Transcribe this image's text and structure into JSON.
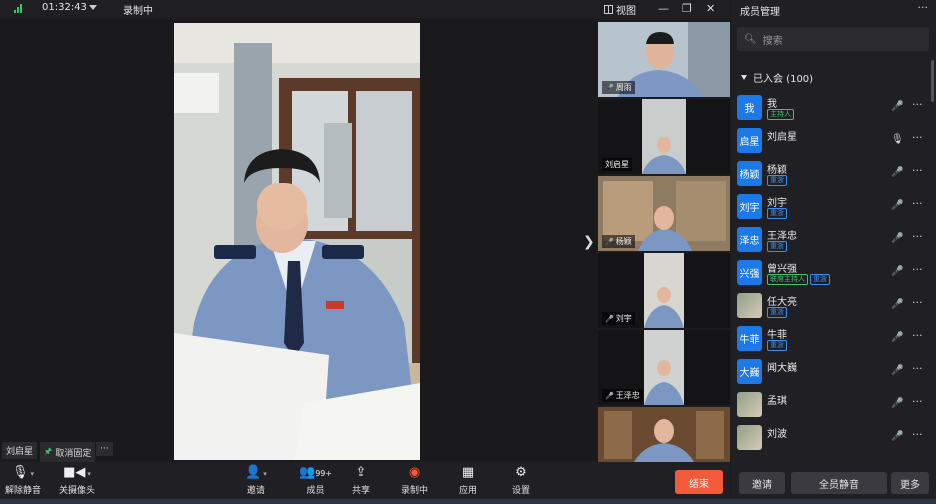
{
  "topbar": {
    "timer": "01:32:43",
    "recording_status": "录制中",
    "view_label": "视图",
    "colors": {
      "signal": "#3cc26a"
    }
  },
  "stage": {
    "pinned_name": "刘启星",
    "unpin_label": "取消固定",
    "more_label": "···"
  },
  "tiles": [
    {
      "name": "周雨"
    },
    {
      "name": "刘启星"
    },
    {
      "name": "杨颖"
    },
    {
      "name": "刘宇"
    },
    {
      "name": "王泽忠"
    },
    {
      "name": ""
    }
  ],
  "panel": {
    "title": "成员管理",
    "search_placeholder": "搜索",
    "group_label": "已入会 (100)",
    "members": [
      {
        "avatar": "我",
        "name": "我",
        "badges": [
          {
            "text": "主持人",
            "color": "#3cc26a"
          }
        ],
        "mic": "muted"
      },
      {
        "avatar": "启星",
        "name": "刘启星",
        "badges": [],
        "mic": "on"
      },
      {
        "avatar": "杨颖",
        "name": "杨颖",
        "badges": [
          {
            "text": "重浙",
            "color": "#3a8ef0"
          }
        ],
        "mic": "muted"
      },
      {
        "avatar": "刘宇",
        "name": "刘宇",
        "badges": [
          {
            "text": "重浙",
            "color": "#3a8ef0"
          }
        ],
        "mic": "muted"
      },
      {
        "avatar": "泽忠",
        "name": "王泽忠",
        "badges": [
          {
            "text": "重浙",
            "color": "#3a8ef0"
          }
        ],
        "mic": "muted"
      },
      {
        "avatar": "兴强",
        "name": "曾兴强",
        "badges": [
          {
            "text": "联席主持人",
            "color": "#3cc26a"
          },
          {
            "text": "重浙",
            "color": "#3a8ef0"
          }
        ],
        "mic": "muted"
      },
      {
        "avatar": "",
        "name": "任大亮",
        "badges": [
          {
            "text": "重浙",
            "color": "#3a8ef0"
          }
        ],
        "mic": "muted"
      },
      {
        "avatar": "牛菲",
        "name": "牛菲",
        "badges": [
          {
            "text": "重浙",
            "color": "#3a8ef0"
          }
        ],
        "mic": "muted"
      },
      {
        "avatar": "大巍",
        "name": "闻大巍",
        "badges": [],
        "mic": "muted"
      },
      {
        "avatar": "",
        "name": "孟琪",
        "badges": [],
        "mic": "muted"
      },
      {
        "avatar": "",
        "name": "刘波",
        "badges": [],
        "mic": "muted"
      }
    ]
  },
  "toolbar": {
    "unmute": "解除静音",
    "camera_off": "关摄像头",
    "invite": "邀请",
    "members": "成员",
    "members_count": "99+",
    "share": "共享",
    "recording": "录制中",
    "apps": "应用",
    "settings": "设置",
    "end": "结束"
  },
  "panel_footer": {
    "invite": "邀请",
    "mute_all": "全员静音",
    "more": "更多"
  }
}
